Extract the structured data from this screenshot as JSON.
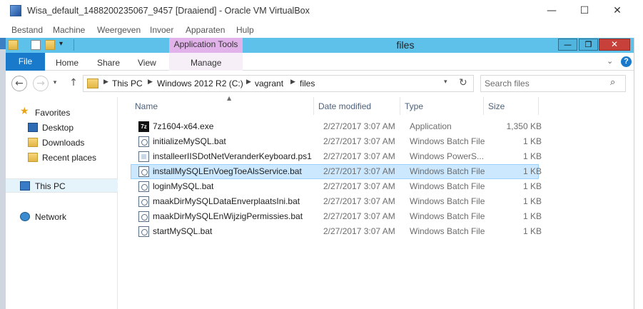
{
  "host": {
    "title": "Wisa_default_1488200235067_9457 [Draaiend] - Oracle VM VirtualBox",
    "controls": {
      "minimize": "—",
      "maximize": "☐",
      "close": "✕"
    },
    "menu": [
      "Bestand",
      "Machine",
      "Weergeven",
      "Invoer",
      "Apparaten",
      "Hulp"
    ]
  },
  "explorer": {
    "window_title": "files",
    "contextual_tab_group": "Application Tools",
    "tabs": {
      "file": "File",
      "home": "Home",
      "share": "Share",
      "view": "View",
      "manage": "Manage"
    },
    "window_controls": {
      "minimize": "—",
      "maximize": "❐",
      "close": "✕"
    },
    "breadcrumb": [
      "This PC",
      "Windows 2012 R2 (C:)",
      "vagrant",
      "files"
    ],
    "search": {
      "placeholder": "Search files"
    },
    "nav_pane": {
      "favorites": "Favorites",
      "desktop": "Desktop",
      "downloads": "Downloads",
      "recent": "Recent places",
      "this_pc": "This PC",
      "network": "Network"
    },
    "columns": {
      "name": "Name",
      "date": "Date modified",
      "type": "Type",
      "size": "Size"
    },
    "files": [
      {
        "name": "7z1604-x64.exe",
        "date": "2/27/2017 3:07 AM",
        "type": "Application",
        "size": "1,350 KB",
        "icon": "7zip-icon"
      },
      {
        "name": "initializeMySQL.bat",
        "date": "2/27/2017 3:07 AM",
        "type": "Windows Batch File",
        "size": "1 KB",
        "icon": "batch-file-icon"
      },
      {
        "name": "installeerIISDotNetVeranderKeyboard.ps1",
        "date": "2/27/2017 3:07 AM",
        "type": "Windows PowerS...",
        "size": "1 KB",
        "icon": "powershell-file-icon"
      },
      {
        "name": "installMySQLEnVoegToeAlsService.bat",
        "date": "2/27/2017 3:07 AM",
        "type": "Windows Batch File",
        "size": "1 KB",
        "icon": "batch-file-icon",
        "selected": true
      },
      {
        "name": "loginMySQL.bat",
        "date": "2/27/2017 3:07 AM",
        "type": "Windows Batch File",
        "size": "1 KB",
        "icon": "batch-file-icon"
      },
      {
        "name": "maakDirMySQLDataEnverplaatsIni.bat",
        "date": "2/27/2017 3:07 AM",
        "type": "Windows Batch File",
        "size": "1 KB",
        "icon": "batch-file-icon"
      },
      {
        "name": "maakDirMySQLEnWijzigPermissies.bat",
        "date": "2/27/2017 3:07 AM",
        "type": "Windows Batch File",
        "size": "1 KB",
        "icon": "batch-file-icon"
      },
      {
        "name": "startMySQL.bat",
        "date": "2/27/2017 3:07 AM",
        "type": "Windows Batch File",
        "size": "1 KB",
        "icon": "batch-file-icon"
      }
    ]
  },
  "colors": {
    "title_band": "#5ec1ea",
    "file_tab": "#1979ca",
    "app_tools": "#e2b3ea",
    "close_red": "#c7403a",
    "selection": "#cce8ff"
  }
}
